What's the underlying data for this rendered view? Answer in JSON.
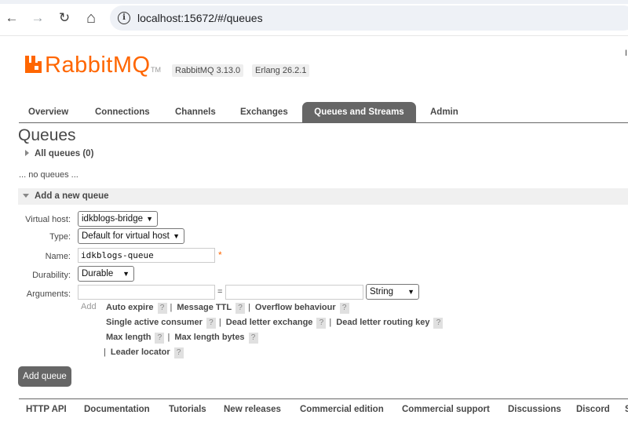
{
  "browser": {
    "url": "localhost:15672/#/queues",
    "back_icon": "←",
    "forward_icon": "→",
    "reload_icon": "↻",
    "home_icon": "⌂",
    "info_icon": "i"
  },
  "header": {
    "logo_text": "RabbitMQ",
    "logo_tm": "TM",
    "rabbitmq_version": "RabbitMQ 3.13.0",
    "erlang_version": "Erlang 26.2.1",
    "corner_text": "I"
  },
  "tabs": [
    {
      "label": "Overview"
    },
    {
      "label": "Connections"
    },
    {
      "label": "Channels"
    },
    {
      "label": "Exchanges"
    },
    {
      "label": "Queues and Streams",
      "active": true
    },
    {
      "label": "Admin"
    }
  ],
  "page_title": "Queues",
  "all_queues": {
    "label": "All queues (0)",
    "empty_text": "... no queues ..."
  },
  "add_queue": {
    "section_title": "Add a new queue",
    "virtual_host": {
      "label": "Virtual host:",
      "value": "idkblogs-bridge"
    },
    "type": {
      "label": "Type:",
      "value": "Default for virtual host"
    },
    "name": {
      "label": "Name:",
      "value": "idkblogs-queue",
      "required_mark": "*"
    },
    "durability": {
      "label": "Durability:",
      "value": "Durable"
    },
    "arguments": {
      "label": "Arguments:",
      "equals": "=",
      "type_value": "String",
      "add_label": "Add",
      "rows": [
        [
          "Auto expire",
          "Message TTL",
          "Overflow behaviour"
        ],
        [
          "Single active consumer",
          "Dead letter exchange",
          "Dead letter routing key"
        ],
        [
          "Max length",
          "Max length bytes"
        ],
        [
          "Leader locator"
        ]
      ],
      "help_mark": "?",
      "separator": "|"
    },
    "submit_label": "Add queue"
  },
  "footer": {
    "links": [
      "HTTP API",
      "Documentation",
      "Tutorials",
      "New releases",
      "Commercial edition",
      "Commercial support",
      "Discussions",
      "Discord",
      "S"
    ]
  },
  "colors": {
    "brand": "#ff6600",
    "tab_active": "#666666",
    "text": "#484848"
  }
}
